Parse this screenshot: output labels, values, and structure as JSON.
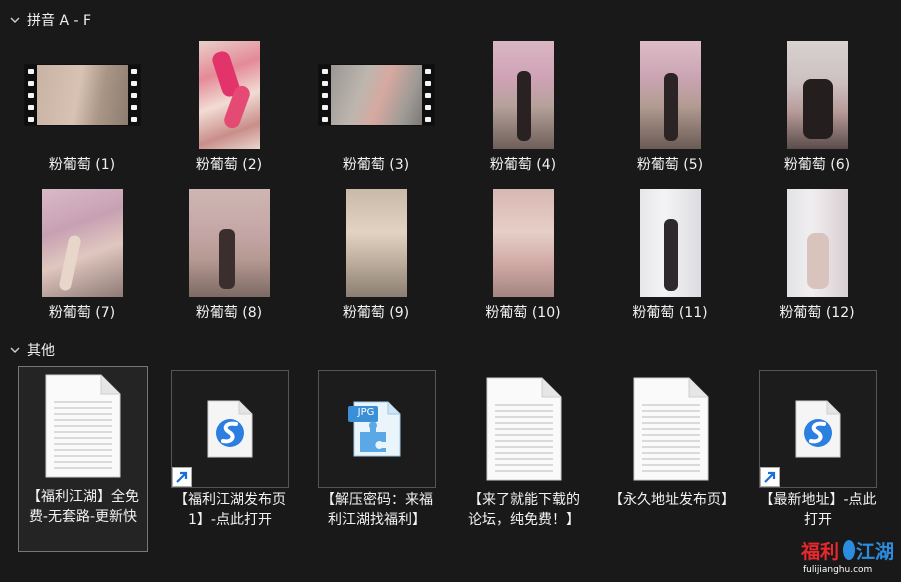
{
  "groups": {
    "pinyin": {
      "title": "拼音 A - F"
    },
    "other": {
      "title": "其他"
    }
  },
  "media_items": [
    {
      "label": "粉葡萄 (1)",
      "kind": "video"
    },
    {
      "label": "粉葡萄 (2)",
      "kind": "photo"
    },
    {
      "label": "粉葡萄 (3)",
      "kind": "video"
    },
    {
      "label": "粉葡萄 (4)",
      "kind": "photo"
    },
    {
      "label": "粉葡萄 (5)",
      "kind": "photo"
    },
    {
      "label": "粉葡萄 (6)",
      "kind": "photo"
    },
    {
      "label": "粉葡萄 (7)",
      "kind": "photo"
    },
    {
      "label": "粉葡萄 (8)",
      "kind": "photo"
    },
    {
      "label": "粉葡萄 (9)",
      "kind": "photo"
    },
    {
      "label": "粉葡萄 (10)",
      "kind": "photo"
    },
    {
      "label": "粉葡萄 (11)",
      "kind": "photo"
    },
    {
      "label": "粉葡萄 (12)",
      "kind": "photo"
    }
  ],
  "other_items": [
    {
      "label": "【福利江湖】全免费-无套路-更新快",
      "icon": "text-document-icon",
      "selected": true
    },
    {
      "label": "【福利江湖发布页1】-点此打开",
      "icon": "browser-shortcut-icon"
    },
    {
      "label": "【解压密码：来福利江湖找福利】",
      "icon": "jpg-file-icon"
    },
    {
      "label": "【来了就能下载的论坛，纯免费！】",
      "icon": "text-document-icon"
    },
    {
      "label": "【永久地址发布页】",
      "icon": "text-document-icon"
    },
    {
      "label": "【最新地址】-点此打开",
      "icon": "browser-shortcut-icon"
    }
  ],
  "file_badge": {
    "jpg": "JPG"
  },
  "watermark": {
    "text": "福利江湖",
    "url": "fulijianghu.com"
  },
  "colors": {
    "background": "#191919",
    "text": "#ffffff",
    "selection_border": "#777777",
    "shortcut_arrow": "#1a6fd8"
  }
}
